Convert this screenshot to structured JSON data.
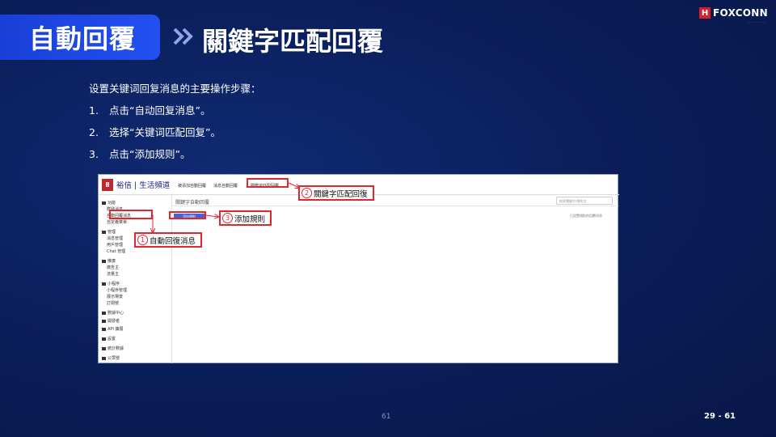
{
  "header": {
    "title": "自動回覆",
    "subtitle": "關鍵字匹配回覆"
  },
  "brand": {
    "name": "FOXCONN",
    "logo_letter": "H",
    "tagline": "··· ·· ······ ·· ·······"
  },
  "intro": "设置关键词回复消息的主要操作步骤：",
  "steps": [
    {
      "num": "1.",
      "text": "点击“自动回复消息”。"
    },
    {
      "num": "2.",
      "text": "选择“关键词匹配回复”。"
    },
    {
      "num": "3.",
      "text": "点击“添加规则”。"
    }
  ],
  "screenshot": {
    "logo_text": "裕信 | 生活頻道",
    "top_tabs": [
      "被添加自動回覆",
      "消息自動回覆",
      "關鍵字匹配回覆"
    ],
    "sidebar": {
      "items": [
        {
          "label": "功能",
          "icon": "grid-icon"
        },
        {
          "label": "群發消息",
          "icon": ""
        },
        {
          "label": "自動回覆消息",
          "icon": ""
        },
        {
          "label": "自定義菜單",
          "icon": ""
        },
        {
          "label": "管理",
          "icon": "folder-icon"
        },
        {
          "label": "消息管理",
          "icon": ""
        },
        {
          "label": "用戶管理",
          "icon": ""
        },
        {
          "label": "Chat 管理",
          "icon": ""
        },
        {
          "label": "推廣",
          "icon": "megaphone-icon"
        },
        {
          "label": "廣告主",
          "icon": ""
        },
        {
          "label": "流量主",
          "icon": ""
        },
        {
          "label": "小程序",
          "icon": "box-icon"
        },
        {
          "label": "小程序管理",
          "icon": ""
        },
        {
          "label": "展示場景",
          "icon": ""
        },
        {
          "label": "訂閱號",
          "icon": ""
        },
        {
          "label": "數據中心",
          "icon": "chart-icon"
        },
        {
          "label": "開發者",
          "icon": "code-icon"
        },
        {
          "label": "API 擴展",
          "icon": "plug-icon"
        },
        {
          "label": "設置",
          "icon": "gear-icon"
        },
        {
          "label": "統計數據",
          "icon": "stats-icon"
        },
        {
          "label": "公眾號",
          "icon": "account-icon"
        }
      ]
    },
    "main_title": "關鍵字自動回覆",
    "search_placeholder": "搜索關鍵字/規則名",
    "add_button": "添加規則",
    "hint": "已設置規則的回覆消息"
  },
  "callouts": [
    {
      "num": "1",
      "text": "自動回復消息"
    },
    {
      "num": "2",
      "text": "關鍵字匹配回復"
    },
    {
      "num": "3",
      "text": "添加規則"
    }
  ],
  "footer": {
    "page_center": "61",
    "page_right": "29 - 61"
  },
  "colors": {
    "accent_red": "#e3262e",
    "title_blue": "#2250f0",
    "background": "#0b1f5c"
  }
}
